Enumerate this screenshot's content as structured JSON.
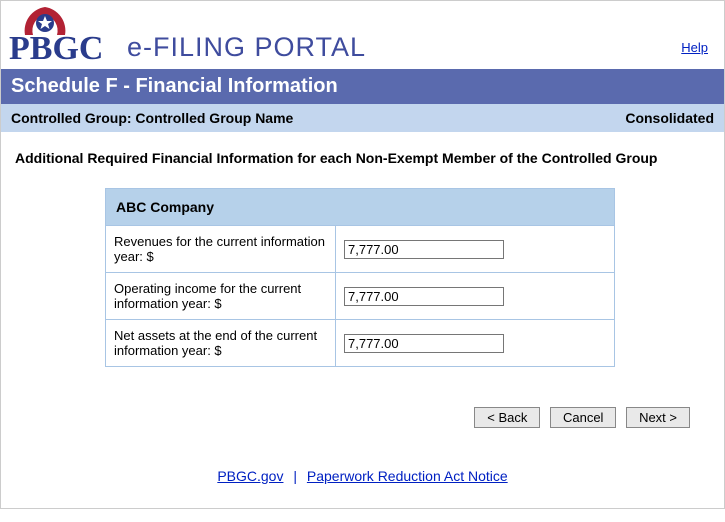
{
  "header": {
    "portal_title": "e-FILING PORTAL",
    "help": "Help"
  },
  "section_title": "Schedule F - Financial Information",
  "subbar": {
    "left": "Controlled Group: Controlled Group Name",
    "right": "Consolidated"
  },
  "instruction": "Additional Required Financial Information for each Non-Exempt Member of the Controlled Group",
  "company": {
    "name": "ABC Company",
    "rows": [
      {
        "label": "Revenues for the current information year:  $",
        "value": "7,777.00"
      },
      {
        "label": "Operating income for the current information year:  $",
        "value": "7,777.00"
      },
      {
        "label": "Net assets at the end of the current information year:  $",
        "value": "7,777.00"
      }
    ]
  },
  "buttons": {
    "back": "< Back",
    "cancel": "Cancel",
    "next": "Next >"
  },
  "footer": {
    "pbgc": "PBGC.gov",
    "pra": "Paperwork Reduction Act Notice"
  }
}
